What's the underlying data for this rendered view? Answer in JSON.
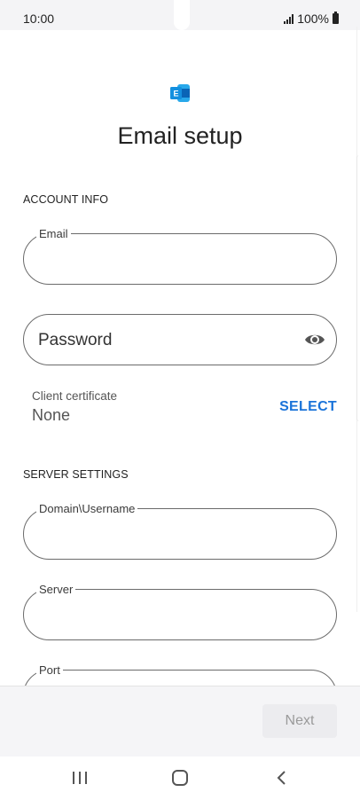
{
  "status_bar": {
    "time": "10:00",
    "battery_text": "100%",
    "signal_icon": "signal-bars-icon",
    "battery_icon": "battery-icon"
  },
  "app": {
    "logo_icon": "exchange-logo-icon",
    "logo_letter": "E",
    "brand_colors": [
      "#0a64b6",
      "#28a8ea",
      "#1490df"
    ]
  },
  "page": {
    "title": "Email setup"
  },
  "account_info": {
    "header": "ACCOUNT INFO",
    "email_label": "Email",
    "email_value": "",
    "password_placeholder": "Password",
    "password_icon": "eye-icon",
    "cert_label": "Client certificate",
    "cert_value": "None",
    "select_label": "SELECT"
  },
  "server_settings": {
    "header": "SERVER SETTINGS",
    "domain_label": "Domain\\Username",
    "server_label": "Server",
    "port_label": "Port"
  },
  "footer": {
    "next_label": "Next",
    "next_enabled": false
  },
  "nav": {
    "recents_icon": "recents-icon",
    "home_icon": "home-icon",
    "back_icon": "back-icon"
  },
  "colors": {
    "accent": "#1a73d9",
    "border": "#6b6b6b",
    "disabled_text": "#9a9a9a"
  }
}
